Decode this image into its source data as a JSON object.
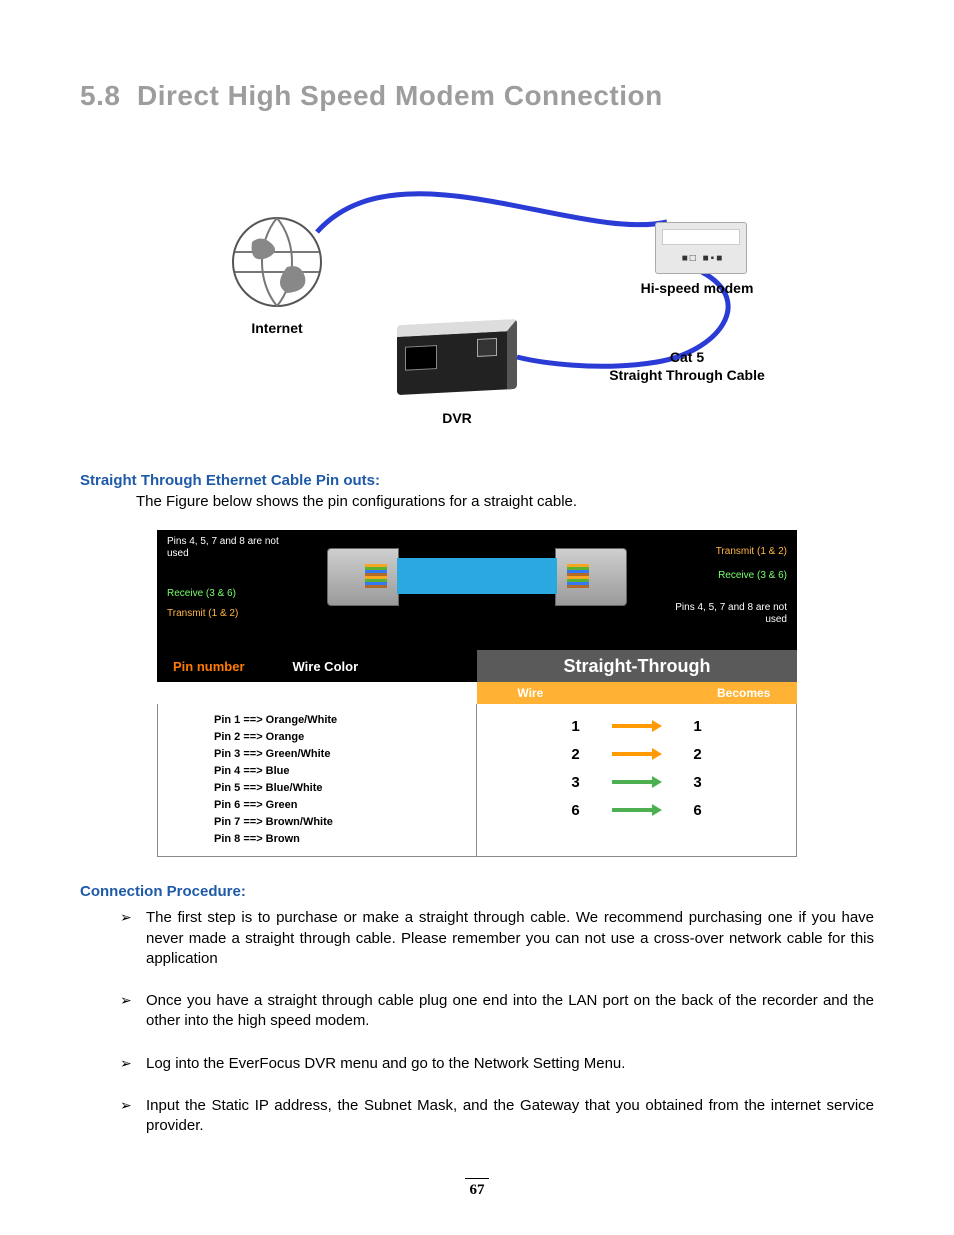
{
  "section": {
    "number": "5.8",
    "title": "Direct High Speed Modem Connection"
  },
  "fig1": {
    "internet_label": "Internet",
    "modem_label": "Hi-speed modem",
    "dvr_label": "DVR",
    "cable_label_top": "Cat 5",
    "cable_label_bottom": "Straight Through Cable"
  },
  "pinouts_heading": "Straight Through Ethernet Cable Pin outs:",
  "pinouts_caption": "The Figure below shows the pin configurations for a straight cable.",
  "fig2": {
    "left_note_unused": "Pins 4, 5, 7 and 8 are not used",
    "left_receive": "Receive (3 & 6)",
    "left_transmit": "Transmit (1 & 2)",
    "right_transmit": "Transmit (1 & 2)",
    "right_receive": "Receive (3 & 6)",
    "right_note_unused": "Pins 4, 5, 7 and 8 are not used",
    "left_header_pin": "Pin number",
    "left_header_color": "Wire Color",
    "right_header_title": "Straight-Through",
    "right_sub_wire": "Wire",
    "right_sub_becomes": "Becomes",
    "pins": [
      "Pin 1 ==> Orange/White",
      "Pin 2 ==> Orange",
      "Pin 3 ==> Green/White",
      "Pin 4 ==> Blue",
      "Pin 5 ==> Blue/White",
      "Pin 6 ==> Green",
      "Pin 7 ==> Brown/White",
      "Pin 8 ==> Brown"
    ],
    "mapping": [
      {
        "a": "1",
        "b": "1",
        "color": "orange"
      },
      {
        "a": "2",
        "b": "2",
        "color": "orange"
      },
      {
        "a": "3",
        "b": "3",
        "color": "green"
      },
      {
        "a": "6",
        "b": "6",
        "color": "green"
      }
    ]
  },
  "procedure_heading": "Connection Procedure:",
  "procedure": [
    "The first step is to purchase or make a straight through cable. We recommend purchasing one if you have never made a straight through cable. Please remember you can not use a cross-over network cable for this application",
    "Once you have a straight through cable plug one end into the LAN port on the back of the recorder and the other into the high speed modem.",
    "Log into the EverFocus DVR menu and go to the Network Setting Menu.",
    "Input the Static IP address, the Subnet Mask, and the Gateway that you obtained from the internet service provider."
  ],
  "page_number": "67"
}
